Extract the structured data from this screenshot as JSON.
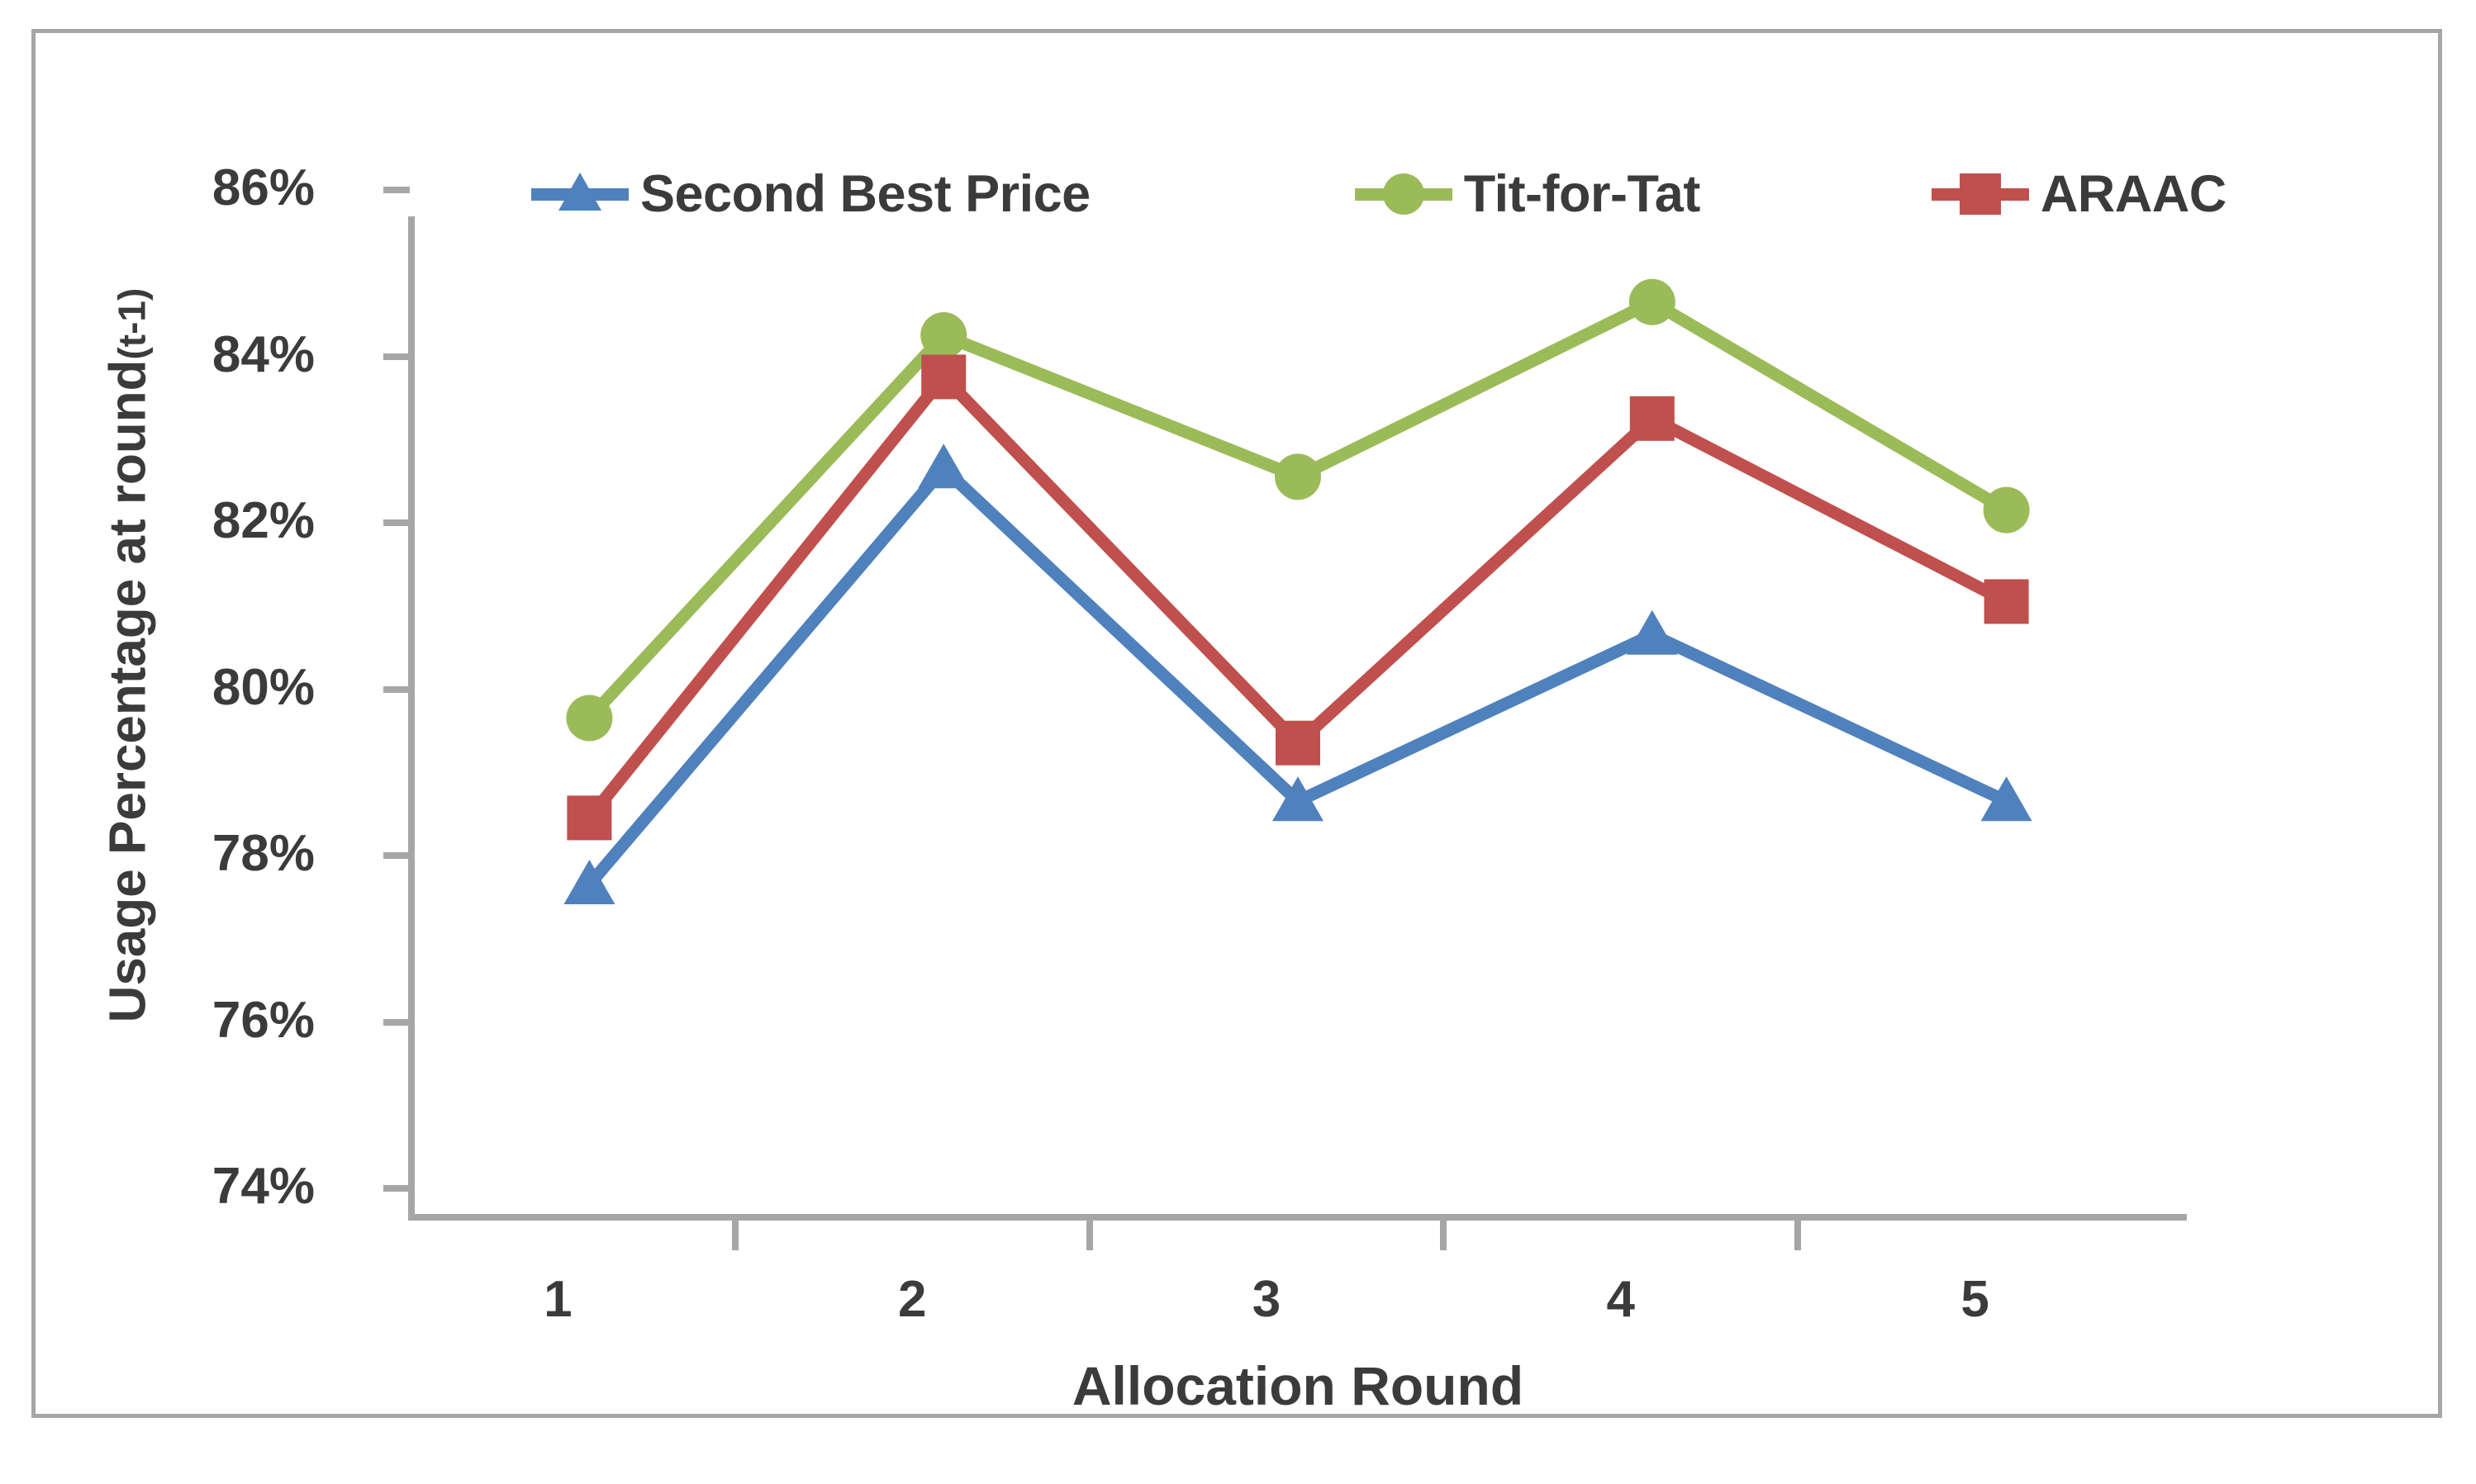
{
  "chart_data": {
    "type": "line",
    "title": "",
    "xlabel": "Allocation Round",
    "ylabel": "Usage Percentage at round",
    "ylabel_sub": "(t-1)",
    "categories": [
      "1",
      "2",
      "3",
      "4",
      "5"
    ],
    "x": [
      1,
      2,
      3,
      4,
      5
    ],
    "ylim": [
      74,
      86
    ],
    "ytick_values": [
      86,
      84,
      82,
      80,
      78,
      76,
      74
    ],
    "ytick_labels": [
      "86%",
      "84%",
      "82%",
      "80%",
      "78%",
      "76%",
      "74%"
    ],
    "grid": false,
    "legend_position": "top",
    "series": [
      {
        "name": "Second Best Price",
        "values": [
          78.0,
          83.0,
          79.0,
          81.0,
          79.0
        ],
        "color": "#4f81bd",
        "marker": "triangle"
      },
      {
        "name": "Tit-for-Tat",
        "values": [
          80.0,
          84.6,
          82.9,
          85.0,
          82.5
        ],
        "color": "#9bbb59",
        "marker": "circle"
      },
      {
        "name": "ARAAC",
        "values": [
          78.8,
          84.1,
          79.7,
          83.6,
          81.4
        ],
        "color": "#c0504d",
        "marker": "square"
      }
    ]
  },
  "legend": {
    "items": [
      {
        "label": "Second Best Price",
        "color": "#4f81bd",
        "marker": "triangle"
      },
      {
        "label": "Tit-for-Tat",
        "color": "#9bbb59",
        "marker": "circle"
      },
      {
        "label": "ARAAC",
        "color": "#c0504d",
        "marker": "square"
      }
    ]
  },
  "colors": {
    "axis": "#a6a6a6",
    "border": "#a6a6a6",
    "text": "#3b3b3b",
    "background": "#ffffff"
  }
}
